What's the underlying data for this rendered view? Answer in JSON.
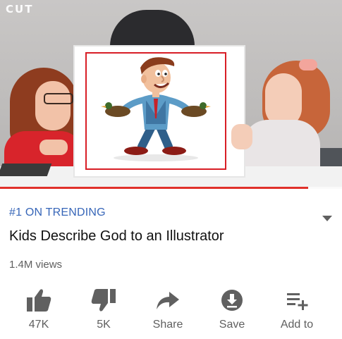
{
  "video": {
    "watermark": "CUT",
    "progress_fraction": 0.9
  },
  "info": {
    "trending_label": "#1 ON TRENDING",
    "title": "Kids Describe God to an Illustrator",
    "views": "1.4M views"
  },
  "actions": [
    {
      "icon": "thumbs-up-icon",
      "label": "47K"
    },
    {
      "icon": "thumbs-down-icon",
      "label": "5K"
    },
    {
      "icon": "share-icon",
      "label": "Share"
    },
    {
      "icon": "save-icon",
      "label": "Save"
    },
    {
      "icon": "add-to-playlist-icon",
      "label": "Add to"
    }
  ],
  "colors": {
    "accent_link": "#3766b8",
    "frame_border": "#d81e26",
    "progress": "#e0312a",
    "icon": "#606060"
  }
}
